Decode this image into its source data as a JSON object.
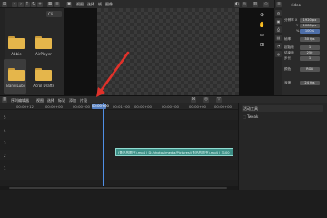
{
  "file_browser": {
    "path_label": "Cli...",
    "folders": [
      {
        "label": "Abbie"
      },
      {
        "label": "AirPlayer"
      },
      {
        "label": "BandiLubi"
      },
      {
        "label": "Acrol Drafts"
      }
    ]
  },
  "viewer": {
    "menu": [
      "视图",
      "选择",
      "帧",
      "图像"
    ]
  },
  "properties": {
    "title": "video",
    "rows": [
      {
        "label": "分辨率 X",
        "value": "1920 px"
      },
      {
        "label": "Y",
        "value": "1080 px"
      },
      {
        "label": "%",
        "value": "100%"
      },
      {
        "label": "帧率",
        "value": "30 fps"
      },
      {
        "label": "起始帧",
        "value": "1"
      },
      {
        "label": "结束帧",
        "value": "250"
      },
      {
        "label": "步长",
        "value": "1"
      },
      {
        "label": "颜色",
        "value": "RGB"
      },
      {
        "label": "深度",
        "value": "24 fps"
      }
    ]
  },
  "timeline": {
    "menu": [
      "序列编辑器",
      "视图",
      "选择",
      "标记",
      "添加",
      "片段"
    ],
    "ruler_ticks": [
      "00:00+12",
      "00:00+00",
      "00:00+00",
      "00:01+00",
      "00:00+00",
      "00:00+00",
      "00:00+00",
      "00:00+00"
    ],
    "playhead_time": "00:00+00",
    "tracks": [
      "5",
      "4",
      "3",
      "2",
      "1"
    ],
    "strip_label": "(鲁迅的图书).mp4 | D:/photos/media/Pictures/(鲁迅的图书).mp4 | 3100",
    "side_header": "活动工具",
    "side_item": "Tweak"
  },
  "colors": {
    "accent": "#5680c2",
    "strip": "#3d8f86",
    "annotation": "#e0312a",
    "folder": "#e5b64b"
  }
}
